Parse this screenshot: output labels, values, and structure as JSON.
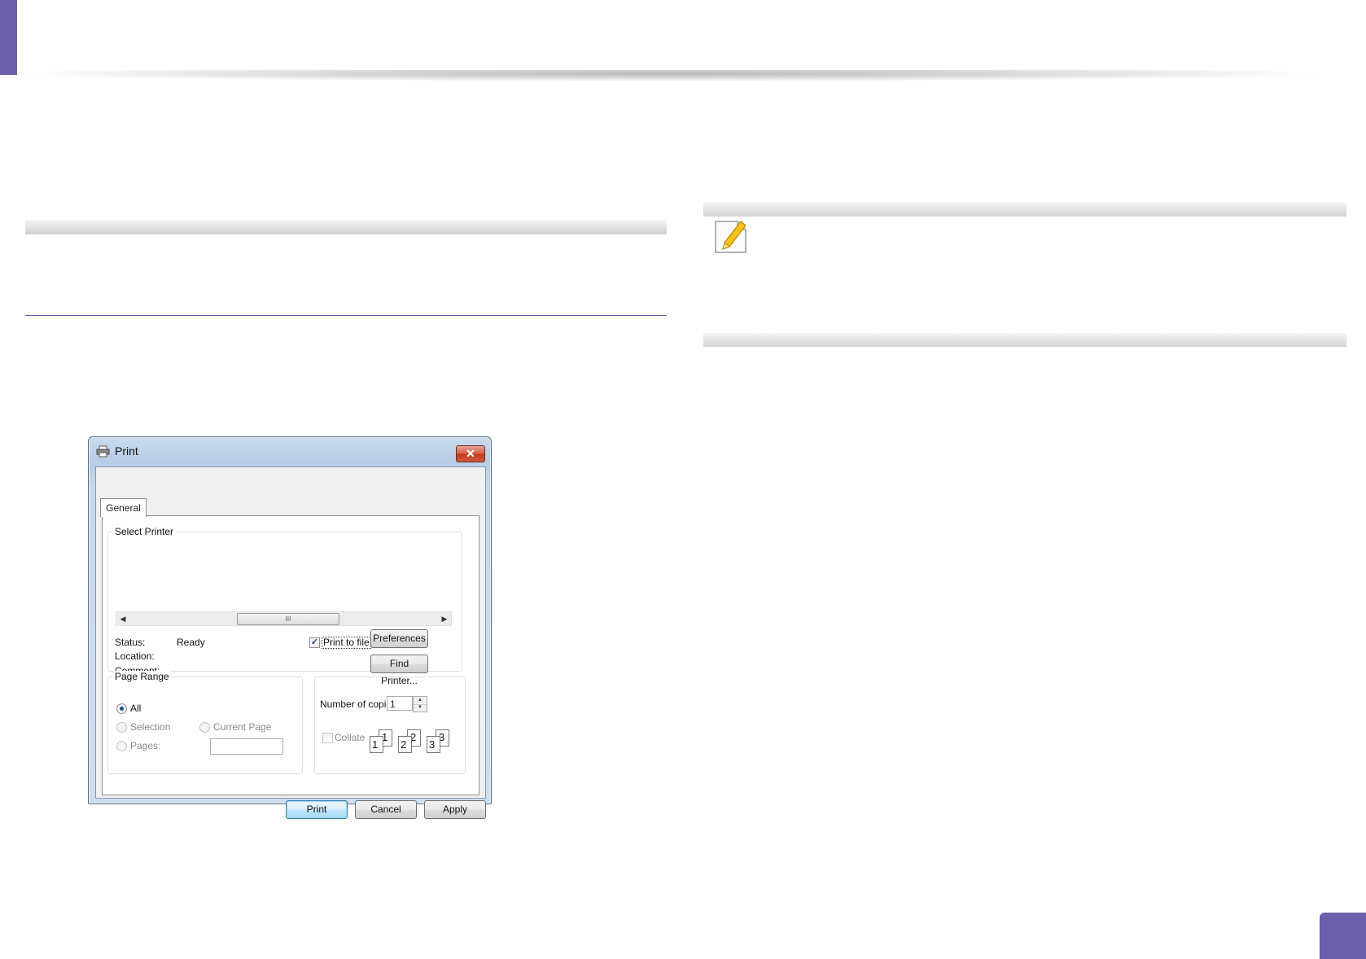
{
  "dialog": {
    "title": "Print",
    "close_glyph": "✕",
    "tab_general": "General",
    "select_printer_legend": "Select Printer",
    "scroll_thumb_glyph": "III",
    "status_label": "Status:",
    "status_value": "Ready",
    "location_label": "Location:",
    "comment_label": "Comment:",
    "print_to_file_label": "Print to file",
    "print_to_file_checked": true,
    "preferences_button": "Preferences",
    "find_printer_button": "Find Printer...",
    "page_range_legend": "Page Range",
    "all_label": "All",
    "selection_label": "Selection",
    "current_page_label": "Current Page",
    "pages_label": "Pages:",
    "copies_label": "Number of copies:",
    "copies_value": "1",
    "collate_label": "Collate",
    "collate_sheets": [
      "1",
      "1",
      "2",
      "2",
      "3",
      "3"
    ],
    "print_button": "Print",
    "cancel_button": "Cancel",
    "apply_button": "Apply"
  },
  "page": {
    "accent_color": "#6a5fa8"
  }
}
